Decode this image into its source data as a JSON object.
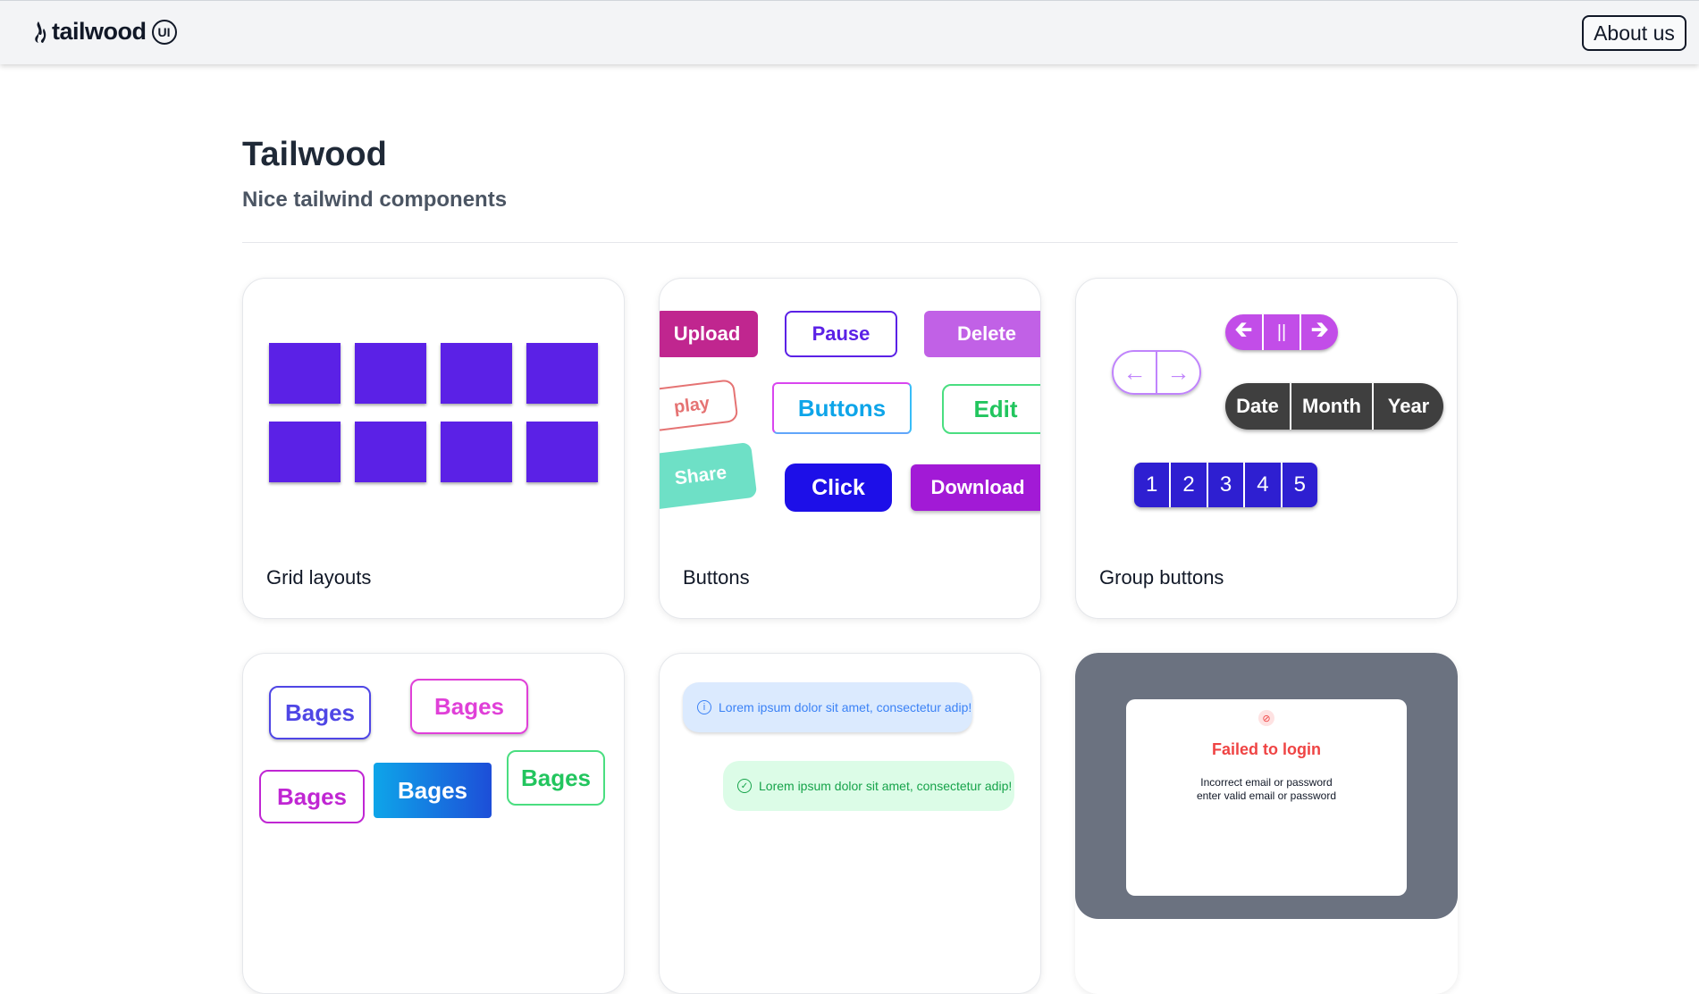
{
  "header": {
    "logo_text": "tailwood",
    "logo_badge": "UI",
    "about_label": "About us"
  },
  "hero": {
    "title": "Tailwood",
    "subtitle": "Nice tailwind components"
  },
  "cards": [
    {
      "label": "Grid layouts"
    },
    {
      "label": "Buttons"
    },
    {
      "label": "Group buttons"
    }
  ],
  "buttons_preview": {
    "upload": "Upload",
    "pause": "Pause",
    "delete": "Delete",
    "play": "play",
    "buttons": "Buttons",
    "edit": "Edit",
    "share": "Share",
    "click": "Click",
    "download": "Download"
  },
  "group_preview": {
    "arrow_left": "←",
    "arrow_right": "→",
    "pause": "||",
    "date": "Date",
    "month": "Month",
    "year": "Year",
    "pages": [
      "1",
      "2",
      "3",
      "4",
      "5"
    ]
  },
  "badges_preview": {
    "badge": "Bages"
  },
  "alerts_preview": {
    "info_text": "Lorem ipsum dolor sit amet, consectetur adip!",
    "success_text": "Lorem ipsum dolor sit amet, consectetur adip!"
  },
  "modal_preview": {
    "title": "Failed to login",
    "line1": "Incorrect email or password",
    "line2": "enter valid email or password"
  },
  "colors": {
    "grid_square": "#5b21e6",
    "group_dark": "#3f3f3f",
    "group_purple": "#c026d3",
    "pagination_blue": "#2e1fd1",
    "modal_overlay": "#6b7280",
    "modal_error": "#ef4444"
  }
}
